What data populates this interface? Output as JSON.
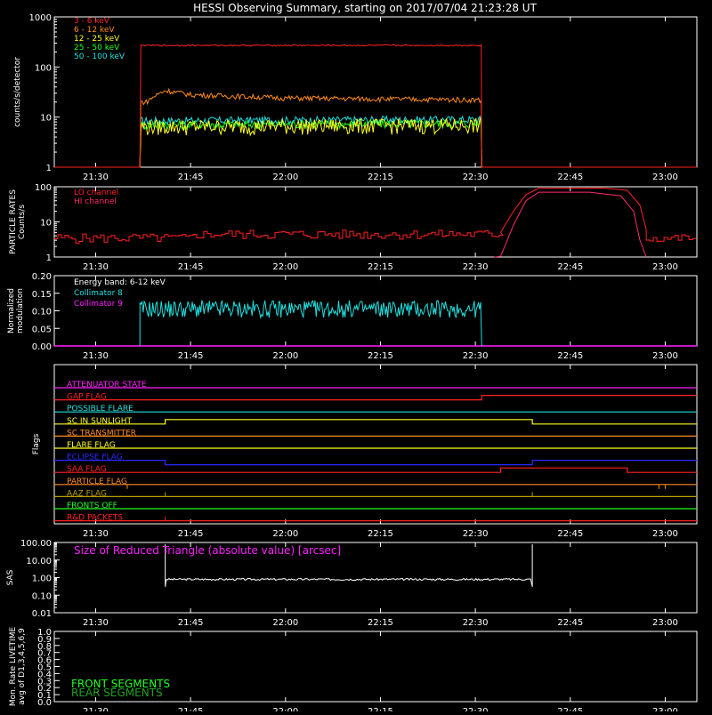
{
  "title": "HESSI Observing Summary, starting on 2017/07/04 21:23:28 UT",
  "time_ticks": [
    "21:30",
    "21:45",
    "22:00",
    "22:15",
    "22:30",
    "22:45",
    "23:00"
  ],
  "chart_data": [
    {
      "id": "count-rates",
      "type": "line",
      "ylabel": "counts/s/detector",
      "yscale": "log",
      "ylim": [
        1,
        1000
      ],
      "xlim": [
        "21:23:28",
        "23:05"
      ],
      "ytick_labels": [
        "1",
        "10",
        "100",
        "1000"
      ],
      "ytick_values": [
        1,
        10,
        100,
        1000
      ],
      "legend_position": "top-left",
      "series": [
        {
          "name": "3 - 6 keV",
          "color": "#ff2020",
          "x": [
            "21:37",
            "21:37:30",
            "22:31"
          ],
          "y": [
            1,
            270,
            270
          ]
        },
        {
          "name": "6 - 12 keV",
          "color": "#ff8c1a",
          "x": [
            "21:37",
            "21:38",
            "21:41",
            "21:45",
            "22:00",
            "22:15",
            "22:31"
          ],
          "y": [
            1,
            20,
            34,
            28,
            24,
            23,
            22
          ]
        },
        {
          "name": "12 - 25 keV",
          "color": "#ffff20",
          "x": [
            "21:37",
            "21:38",
            "22:31"
          ],
          "y": [
            1,
            6.5,
            7
          ]
        },
        {
          "name": "25 - 50 keV",
          "color": "#20ff20",
          "x": [
            "21:37",
            "21:38",
            "22:31"
          ],
          "y": [
            1,
            7,
            7.5
          ]
        },
        {
          "name": "50 - 100 keV",
          "color": "#20e0e0",
          "x": [
            "21:37",
            "21:38",
            "22:31"
          ],
          "y": [
            1,
            8.5,
            9
          ]
        }
      ]
    },
    {
      "id": "particle-rates",
      "type": "line",
      "ylabel": "PARTICLE RATES Counts/s",
      "yscale": "log",
      "ylim": [
        1,
        100
      ],
      "ytick_labels": [
        "1",
        "10",
        "100"
      ],
      "ytick_values": [
        1,
        10,
        100
      ],
      "legend_position": "top-left",
      "series": [
        {
          "name": "LO channel",
          "color": "#ff2020",
          "x": [
            "21:23:28",
            "21:45",
            "22:30",
            "22:34",
            "22:40",
            "22:55",
            "22:58",
            "23:05"
          ],
          "y": [
            3,
            4,
            5,
            5,
            90,
            90,
            4,
            3
          ]
        },
        {
          "name": "HI channel",
          "color": "#ff2a6a",
          "x": [
            "22:33",
            "22:34",
            "22:40",
            "22:55",
            "22:57"
          ],
          "y": [
            1,
            1,
            70,
            70,
            1
          ]
        }
      ]
    },
    {
      "id": "modulation",
      "type": "line",
      "ylabel": "Normalized modulation",
      "ylim": [
        0,
        0.2
      ],
      "ytick_labels": [
        "0.00",
        "0.05",
        "0.10",
        "0.15",
        "0.20"
      ],
      "ytick_values": [
        0,
        0.05,
        0.1,
        0.15,
        0.2
      ],
      "annotation": "Energy band: 6-12 keV",
      "legend_position": "top-left",
      "series": [
        {
          "name": "Collimator 8",
          "color": "#20e0e0",
          "x": [
            "21:37",
            "22:31"
          ],
          "y": [
            0.105,
            0.105
          ]
        },
        {
          "name": "Collimator 9",
          "color": "#ff20ff",
          "x": [
            "21:23:28",
            "23:05"
          ],
          "y": [
            0,
            0
          ]
        }
      ]
    },
    {
      "id": "flags",
      "type": "line",
      "ylabel": "Flags",
      "flags": [
        {
          "name": "ATTENUATOR STATE",
          "color": "#ff20ff",
          "changes": []
        },
        {
          "name": "GAP FLAG",
          "color": "#ff2020",
          "changes": [
            "22:31"
          ]
        },
        {
          "name": "POSSIBLE FLARE",
          "color": "#20e0e0",
          "changes": []
        },
        {
          "name": "SC IN SUNLIGHT",
          "color": "#ffff20",
          "changes": [
            "21:41",
            "22:39"
          ]
        },
        {
          "name": "SC TRANSMITTER",
          "color": "#ff8c1a",
          "changes": []
        },
        {
          "name": "FLARE FLAG",
          "color": "#ffff20",
          "changes": []
        },
        {
          "name": "ECLIPSE FLAG",
          "color": "#2a2aff",
          "changes": [
            "21:41",
            "22:39"
          ]
        },
        {
          "name": "SAA FLAG",
          "color": "#ff2020",
          "changes": [
            "22:34",
            "22:54"
          ]
        },
        {
          "name": "PARTICLE FLAG",
          "color": "#ff8c1a",
          "changes": []
        },
        {
          "name": "AAZ FLAG",
          "color": "#b8a000",
          "changes": []
        },
        {
          "name": "FRONTS OFF",
          "color": "#20ff20",
          "changes": []
        },
        {
          "name": "R&D PACKETS",
          "color": "#ff2020",
          "changes": []
        }
      ]
    },
    {
      "id": "sas",
      "type": "line",
      "ylabel": "SAS",
      "yscale": "log",
      "ylim": [
        0.01,
        100
      ],
      "ytick_labels": [
        "0.01",
        "0.10",
        "1.00",
        "10.00",
        "100.00"
      ],
      "ytick_values": [
        0.01,
        0.1,
        1,
        10,
        100
      ],
      "annotation": "Size of Reduced Triangle (absolute value) [arcsec]",
      "series": [
        {
          "color": "#ffffff",
          "x": [
            "21:41",
            "22:39"
          ],
          "y": [
            0.8,
            0.8
          ]
        }
      ]
    },
    {
      "id": "livetime",
      "type": "line",
      "ylabel": "Mon. Rate LIVETIME avg of D1,3,4,5,6,9",
      "ylim": [
        0,
        1
      ],
      "ytick_labels": [
        "0.0",
        "0.1",
        "0.2",
        "0.3",
        "0.4",
        "0.5",
        "0.6",
        "0.7",
        "0.8",
        "0.9",
        "1.0"
      ],
      "ytick_values": [
        0,
        0.1,
        0.2,
        0.3,
        0.4,
        0.5,
        0.6,
        0.7,
        0.8,
        0.9,
        1.0
      ],
      "legend_position": "bottom-left",
      "series": [
        {
          "name": "FRONT SEGMENTS",
          "color": "#20ff20",
          "x": [],
          "y": []
        },
        {
          "name": "REAR SEGMENTS",
          "color": "#20a020",
          "x": [],
          "y": []
        }
      ]
    }
  ]
}
